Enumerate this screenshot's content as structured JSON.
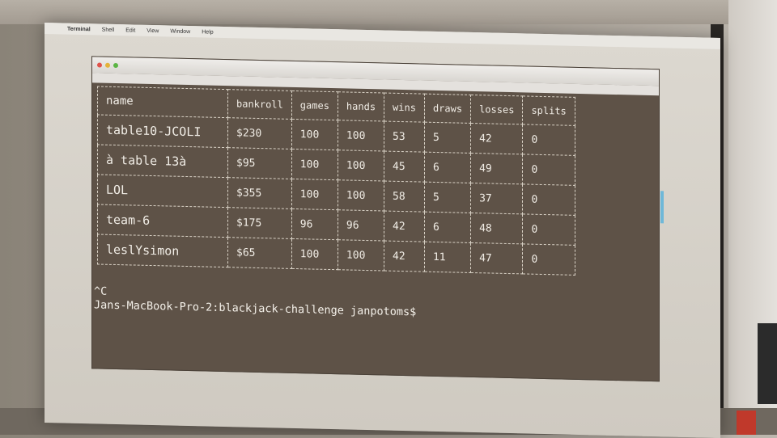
{
  "menubar": {
    "app": "Terminal",
    "items": [
      "Shell",
      "Edit",
      "View",
      "Window",
      "Help"
    ]
  },
  "table": {
    "headers": [
      "name",
      "bankroll",
      "games",
      "hands",
      "wins",
      "draws",
      "losses",
      "splits"
    ],
    "rows": [
      [
        "table10-JCOLI",
        "$230",
        "100",
        "100",
        "53",
        "5",
        "42",
        "0"
      ],
      [
        "à table 13à",
        "$95",
        "100",
        "100",
        "45",
        "6",
        "49",
        "0"
      ],
      [
        "LOL",
        "$355",
        "100",
        "100",
        "58",
        "5",
        "37",
        "0"
      ],
      [
        "team-6",
        "$175",
        "96",
        "96",
        "42",
        "6",
        "48",
        "0"
      ],
      [
        "leslYsimon",
        "$65",
        "100",
        "100",
        "42",
        "11",
        "47",
        "0"
      ]
    ]
  },
  "prompt": {
    "interrupt": "^C",
    "line": "Jans-MacBook-Pro-2:blackjack-challenge janpotoms$"
  }
}
